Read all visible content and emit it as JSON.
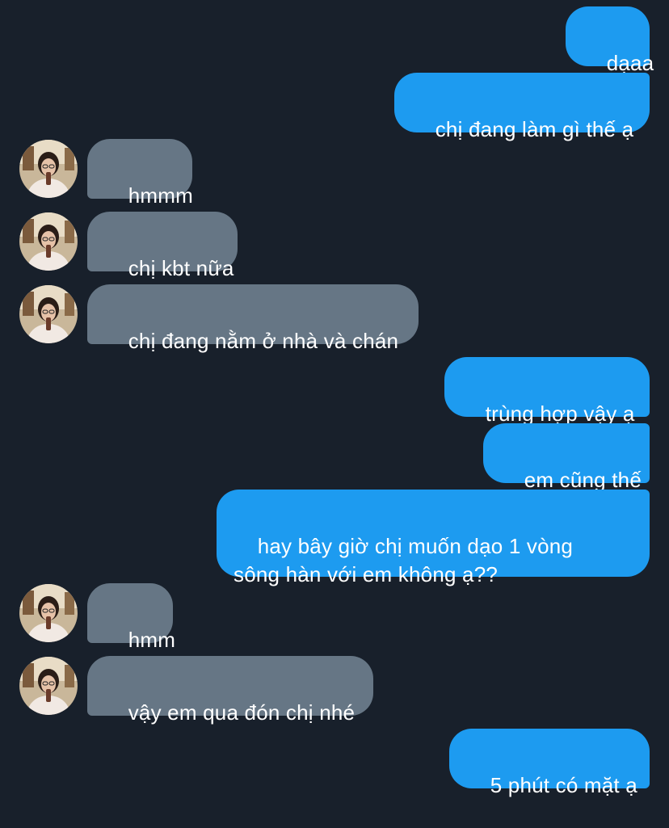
{
  "colors": {
    "background": "#18202b",
    "sent_bubble": "#1d9bf0",
    "received_bubble": "#667685",
    "text": "#ffffff"
  },
  "messages": [
    {
      "side": "sent",
      "text": "dạaa"
    },
    {
      "side": "sent",
      "text": "chị đang làm gì thế ạ"
    },
    {
      "side": "received",
      "text": "hmmm",
      "avatar": "profile-photo"
    },
    {
      "side": "received",
      "text": "chị kbt nữa",
      "avatar": "profile-photo"
    },
    {
      "side": "received",
      "text": "chị đang nằm ở nhà và chán",
      "avatar": "profile-photo"
    },
    {
      "side": "sent",
      "text": "trùng hợp vậy ạ"
    },
    {
      "side": "sent",
      "text": "em cũng thế"
    },
    {
      "side": "sent",
      "text": "hay bây giờ chị muốn dạo 1 vòng\nsông hàn với em không ạ??"
    },
    {
      "side": "received",
      "text": "hmm",
      "avatar": "profile-photo"
    },
    {
      "side": "received",
      "text": "vậy em qua đón chị nhé",
      "avatar": "profile-photo"
    },
    {
      "side": "sent",
      "text": "5 phút có mặt ạ"
    }
  ]
}
